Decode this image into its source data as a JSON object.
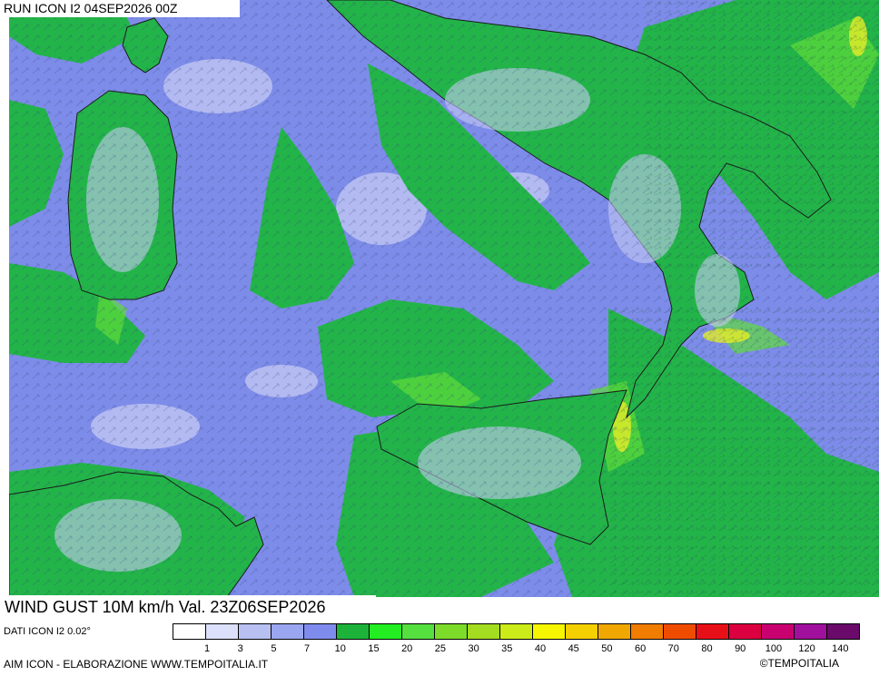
{
  "header": {
    "run_title": "RUN ICON I2 04SEP2026 00Z"
  },
  "footer": {
    "variable_title": "WIND GUST 10M km/h Val. 23Z06SEP2026",
    "data_source": "DATI ICON I2 0.02°",
    "elaboration": "AIM ICON - ELABORAZIONE WWW.TEMPOITALIA.IT",
    "copyright": "©TEMPOITALIA"
  },
  "legend": {
    "ticks": [
      "1",
      "3",
      "5",
      "7",
      "10",
      "15",
      "20",
      "25",
      "30",
      "35",
      "40",
      "45",
      "50",
      "60",
      "70",
      "80",
      "90",
      "100",
      "120",
      "140"
    ],
    "colors": [
      "#ffffff",
      "#dce0fa",
      "#b8c0f2",
      "#9aa7f0",
      "#7f8cee",
      "#1db33a",
      "#22ee22",
      "#55e040",
      "#7ddc2a",
      "#a4dc20",
      "#ccec1a",
      "#f6f600",
      "#f4d000",
      "#f0a800",
      "#f07c00",
      "#f04c00",
      "#e81018",
      "#dc0040",
      "#c80070",
      "#a0109c",
      "#6a0a6a"
    ]
  },
  "map": {
    "colors": {
      "sea": "#7d8ce8",
      "land": "#23b449",
      "coast": "#1a1a1a",
      "light": "#c8cdf4"
    }
  }
}
